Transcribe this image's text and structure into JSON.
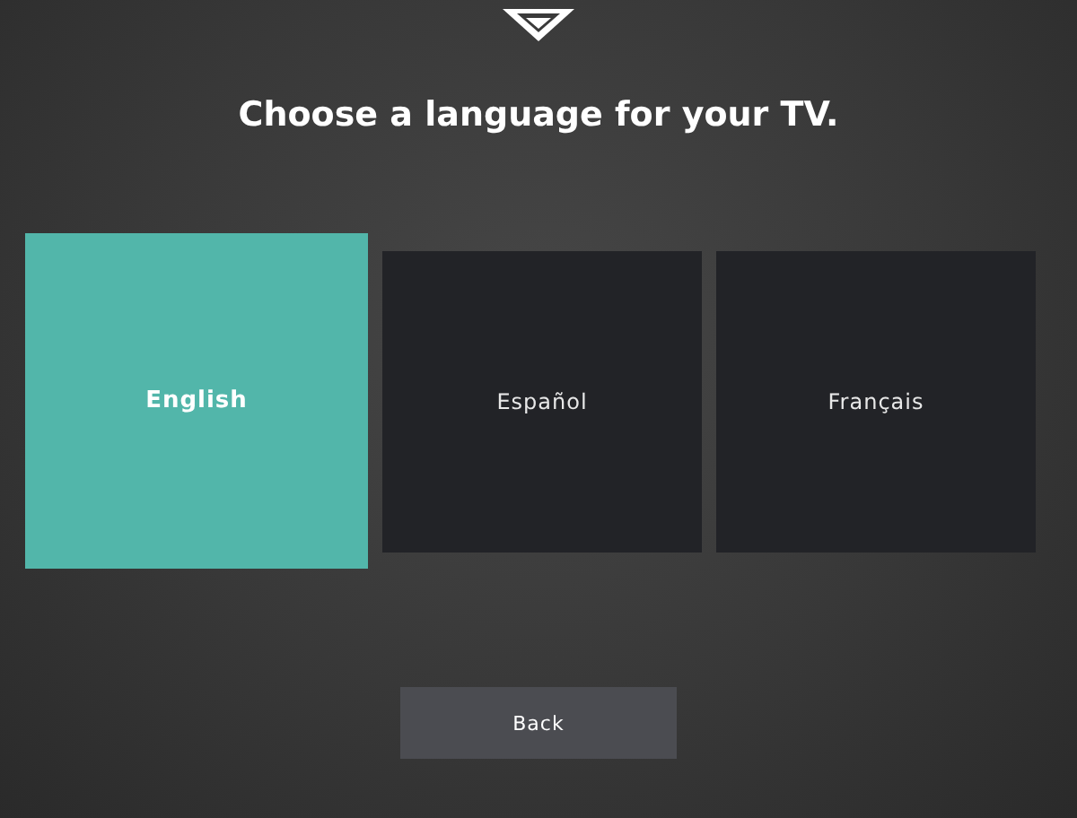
{
  "title": "Choose a language for your TV.",
  "languages": [
    {
      "label": "English",
      "selected": true
    },
    {
      "label": "Español",
      "selected": false
    },
    {
      "label": "Français",
      "selected": false
    }
  ],
  "back_button": "Back"
}
